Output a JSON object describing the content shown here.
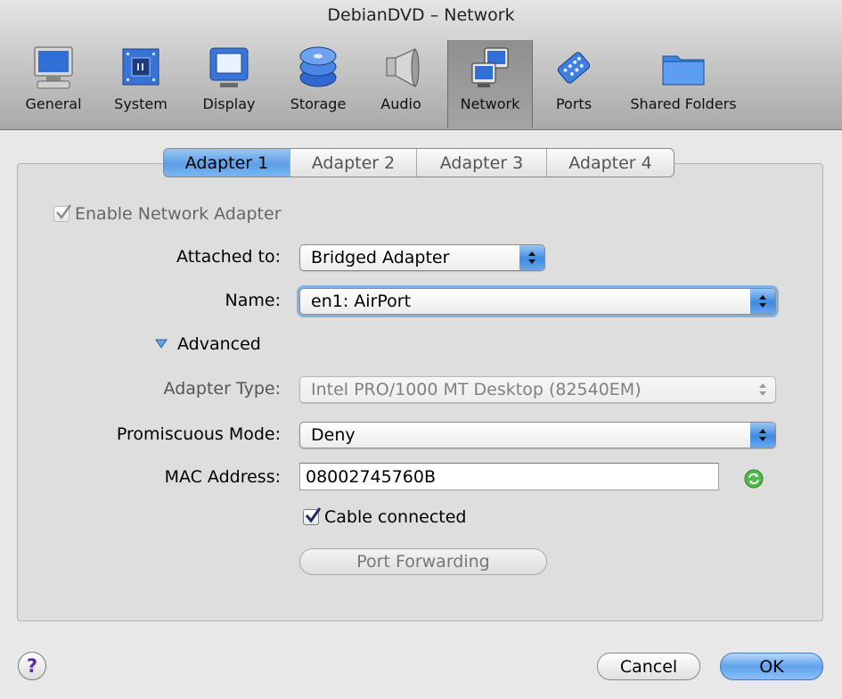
{
  "window": {
    "title": "DebianDVD – Network"
  },
  "toolbar": {
    "items": [
      {
        "label": "General",
        "icon": "monitor-icon"
      },
      {
        "label": "System",
        "icon": "chip-icon"
      },
      {
        "label": "Display",
        "icon": "display-icon"
      },
      {
        "label": "Storage",
        "icon": "disks-icon"
      },
      {
        "label": "Audio",
        "icon": "speaker-icon"
      },
      {
        "label": "Network",
        "icon": "network-icon",
        "selected": true
      },
      {
        "label": "Ports",
        "icon": "port-connector-icon"
      },
      {
        "label": "Shared Folders",
        "icon": "folder-icon"
      }
    ]
  },
  "tabs": [
    "Adapter 1",
    "Adapter 2",
    "Adapter 3",
    "Adapter 4"
  ],
  "form": {
    "enable_label": "Enable Network Adapter",
    "attached_label": "Attached to:",
    "attached_value": "Bridged Adapter",
    "name_label": "Name:",
    "name_value": "en1: AirPort",
    "advanced_label": "Advanced",
    "adapter_type_label": "Adapter Type:",
    "adapter_type_value": "Intel PRO/1000 MT Desktop (82540EM)",
    "promiscuous_label": "Promiscuous Mode:",
    "promiscuous_value": "Deny",
    "mac_label": "MAC Address:",
    "mac_value": "08002745760B",
    "cable_label": "Cable connected",
    "port_forwarding_label": "Port Forwarding"
  },
  "footer": {
    "help_label": "?",
    "cancel_label": "Cancel",
    "ok_label": "OK"
  },
  "colors": {
    "accent_blue": "#5d9ee6",
    "refresh_green": "#3faf3a"
  }
}
